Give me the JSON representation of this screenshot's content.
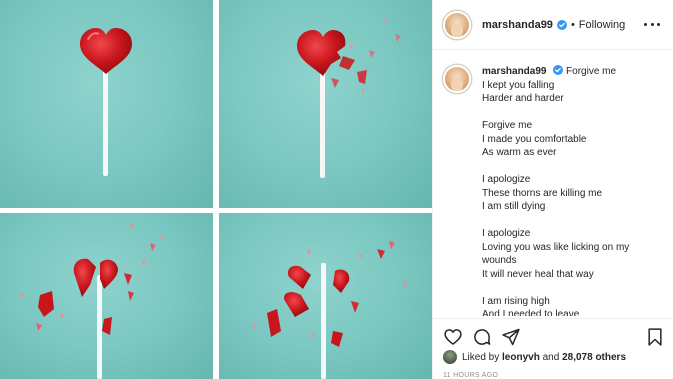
{
  "post": {
    "username": "marshanda99",
    "follow_status": "Following",
    "separator": "•",
    "caption_title": "Forgive me",
    "caption_lines": [
      "I kept you falling",
      "Harder and harder",
      "",
      "Forgive me",
      "I made you comfortable",
      "As warm as ever",
      "",
      "I apologize",
      "These thorns are killing me",
      "I am still dying",
      "",
      "I apologize",
      "Loving you was like licking on my",
      "wounds",
      "It will never heal that way",
      "",
      "I am rising high",
      "And I needed to leave"
    ],
    "likes_prefix": "Liked by",
    "likes_user": "leonyvh",
    "likes_and": "and",
    "likes_count": "28,078 others",
    "timestamp": "11 HOURS AGO"
  },
  "icons": {
    "verified": "verified-badge-icon",
    "more": "more-options-icon",
    "like": "heart-icon",
    "comment": "comment-icon",
    "share": "share-icon",
    "save": "bookmark-icon"
  },
  "colors": {
    "background_teal": "#79c6c0",
    "candy_red": "#c8161d",
    "verified_blue": "#3897f0",
    "text": "#262626",
    "muted": "#8e8e8e"
  }
}
